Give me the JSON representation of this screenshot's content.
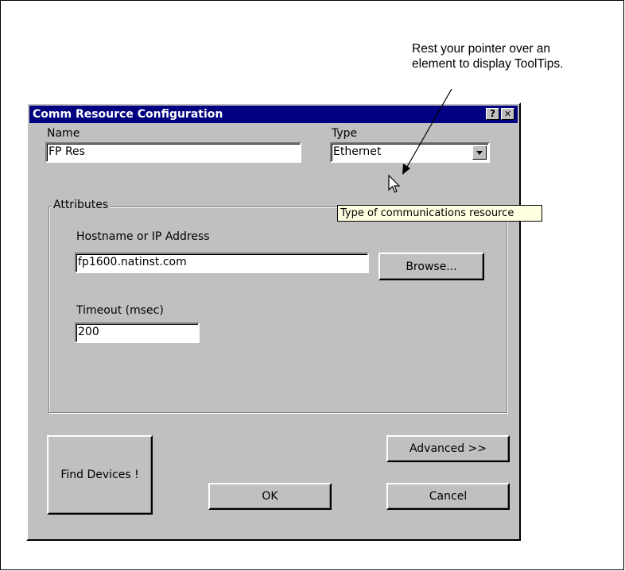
{
  "callout": {
    "line1": "Rest your pointer over an",
    "line2": "element to display ToolTips."
  },
  "dialog": {
    "title": "Comm Resource Configuration",
    "help_label": "?",
    "close_label": "✕",
    "name_label": "Name",
    "name_value": "FP Res",
    "type_label": "Type",
    "type_value": "Ethernet",
    "attributes_label": "Attributes",
    "hostname_label": "Hostname or IP Address",
    "hostname_value": "fp1600.natinst.com",
    "browse_label": "Browse...",
    "timeout_label": "Timeout (msec)",
    "timeout_value": "200",
    "find_devices_label": "Find Devices !",
    "advanced_label": "Advanced  >>",
    "ok_label": "OK",
    "cancel_label": "Cancel"
  },
  "tooltip": {
    "text": "Type of communications resource"
  },
  "icons": {
    "cursor": "arrow-pointer-icon",
    "dropdown": "triangle-down-icon"
  },
  "colors": {
    "titlebar": "#000080",
    "dialog_face": "#c0c0c0",
    "tooltip_bg": "#ffffe1"
  }
}
